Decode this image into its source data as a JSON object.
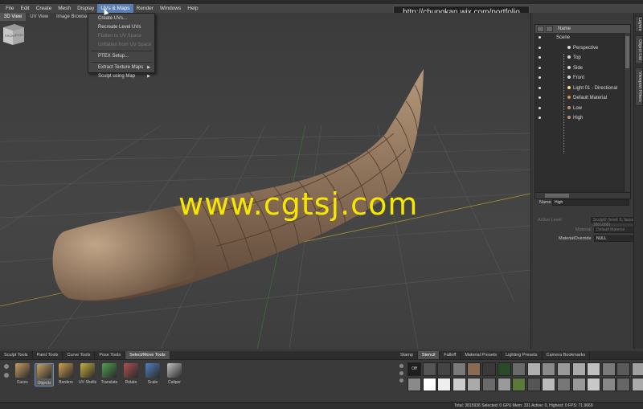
{
  "menu": [
    "File",
    "Edit",
    "Create",
    "Mesh",
    "Display",
    "UVs & Maps",
    "Render",
    "Windows",
    "Help"
  ],
  "active_menu": "UVs & Maps",
  "overlay_url": "http://chungkan.wix.com/portfolio",
  "view_tabs": [
    "3D View",
    "UV View",
    "Image Browser"
  ],
  "dropdown": {
    "items": [
      {
        "label": "Create UVs...",
        "disabled": false,
        "submenu": false
      },
      {
        "label": "Recreate Level UVs",
        "disabled": false,
        "submenu": false
      },
      {
        "label": "Flatten to UV Space",
        "disabled": true,
        "submenu": false
      },
      {
        "label": "Unflatten from UV Space",
        "disabled": true,
        "submenu": false
      },
      {
        "label": "PTEX Setup...",
        "disabled": false,
        "submenu": false
      },
      {
        "label": "Extract Texture Maps",
        "disabled": false,
        "submenu": true
      },
      {
        "label": "Sculpt using Map",
        "disabled": false,
        "submenu": true
      }
    ]
  },
  "viewcube": {
    "front": "FRONT",
    "right": "RIGHT"
  },
  "watermark": "www.cgtsj.com",
  "right_tabs": [
    "Layers",
    "Object List",
    "Viewport Filters"
  ],
  "outliner": {
    "header": "Name",
    "items": [
      {
        "label": "Scene",
        "icon": "none"
      },
      {
        "label": "Perspective",
        "icon": "camera-icon"
      },
      {
        "label": "Top",
        "icon": "camera-icon"
      },
      {
        "label": "Side",
        "icon": "camera-icon"
      },
      {
        "label": "Front",
        "icon": "camera-icon"
      },
      {
        "label": "Light 01 - Directional",
        "icon": "light-icon"
      },
      {
        "label": "Default Material",
        "icon": "material-icon"
      },
      {
        "label": "Low",
        "icon": "mesh-icon"
      },
      {
        "label": "High",
        "icon": "mesh-icon"
      }
    ]
  },
  "properties": {
    "name_label": "Name",
    "name_value": "High",
    "active_level_label": "Active Level",
    "active_level_value": "Sculpt2 (level: 6, faces: 3801088)",
    "material_label": "Material",
    "material_value": "Default Material",
    "override_label": "MaterialOverride",
    "override_value": "NULL"
  },
  "tool_tabs": [
    "Sculpt Tools",
    "Paint Tools",
    "Curve Tools",
    "Pose Tools",
    "Select/Move Tools"
  ],
  "active_tool_tab": "Select/Move Tools",
  "tools": [
    {
      "label": "Faces",
      "icon": "faces-icon",
      "color": "#c8a060"
    },
    {
      "label": "Objects",
      "icon": "objects-icon",
      "color": "#c8a060"
    },
    {
      "label": "Borders",
      "icon": "borders-icon",
      "color": "#d0a050"
    },
    {
      "label": "UV Shells",
      "icon": "uv-shells-icon",
      "color": "#c8b040"
    },
    {
      "label": "Translate",
      "icon": "translate-icon",
      "color": "#50a050"
    },
    {
      "label": "Rotate",
      "icon": "rotate-icon",
      "color": "#b05050"
    },
    {
      "label": "Scale",
      "icon": "scale-icon",
      "color": "#5080c0"
    },
    {
      "label": "Caliper",
      "icon": "caliper-icon",
      "color": "#c0c0c0"
    }
  ],
  "active_tool": "Objects",
  "stamp_tabs": [
    "Stamp",
    "Stencil",
    "Falloff",
    "Material Presets",
    "Lighting Presets",
    "Camera Bookmarks"
  ],
  "active_stamp_tab": "Stencil",
  "stencil_off_label": "Off",
  "stencil_colors": [
    [
      "#222222",
      "#555555",
      "#444444",
      "#7a7a7a",
      "#8a6a50",
      "#3a3a3a",
      "#2a4a2a",
      "#6a6a6a",
      "#b0b0b0",
      "#8a8a8a",
      "#9a9a9a",
      "#aaaaaa",
      "#c0c0c0",
      "#7a7a7a",
      "#5a5a5a",
      "#a0a0a0"
    ],
    [
      "#8a8a8a",
      "#ffffff",
      "#eeeeee",
      "#cccccc",
      "#aaaaaa",
      "#6a6a6a",
      "#9a9a9a",
      "#5a7a3a",
      "#555555",
      "#bbbbbb",
      "#777777",
      "#999999",
      "#c8c8c8",
      "#888888",
      "#666666",
      "#aaaaaa"
    ]
  ],
  "status": "Total: 3815936  Selected: 0  GPU Mem: 331  Active: 0, Highest: 0  FPS: 71.9669"
}
